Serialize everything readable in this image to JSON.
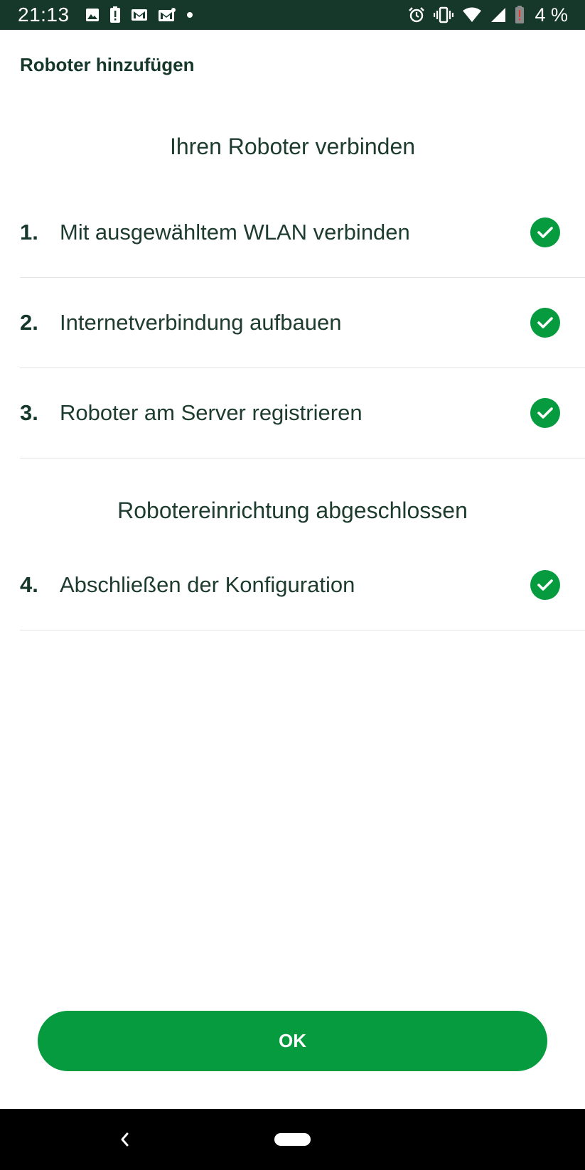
{
  "status_bar": {
    "time": "21:13",
    "battery": "4 %",
    "icons_left": [
      "image-icon",
      "alert-icon",
      "gmail-icon",
      "gmail-icon",
      "dot-icon"
    ],
    "icons_right": [
      "alarm-icon",
      "vibrate-icon",
      "wifi-icon",
      "signal-icon",
      "battery-icon"
    ]
  },
  "header": {
    "title": "Roboter hinzufügen"
  },
  "sections": [
    {
      "heading": "Ihren Roboter verbinden",
      "steps": [
        {
          "number": "1.",
          "label": "Mit ausgewähltem WLAN verbinden",
          "status": "completed"
        },
        {
          "number": "2.",
          "label": "Internetverbindung aufbauen",
          "status": "completed"
        },
        {
          "number": "3.",
          "label": "Roboter am Server registrieren",
          "status": "completed"
        }
      ]
    },
    {
      "heading": "Robotereinrichtung abgeschlossen",
      "steps": [
        {
          "number": "4.",
          "label": "Abschließen der Konfiguration",
          "status": "completed"
        }
      ]
    }
  ],
  "actions": {
    "ok_label": "OK"
  },
  "colors": {
    "accent": "#069b3e",
    "status_bar": "#16382b",
    "text": "#1d3b2e"
  }
}
